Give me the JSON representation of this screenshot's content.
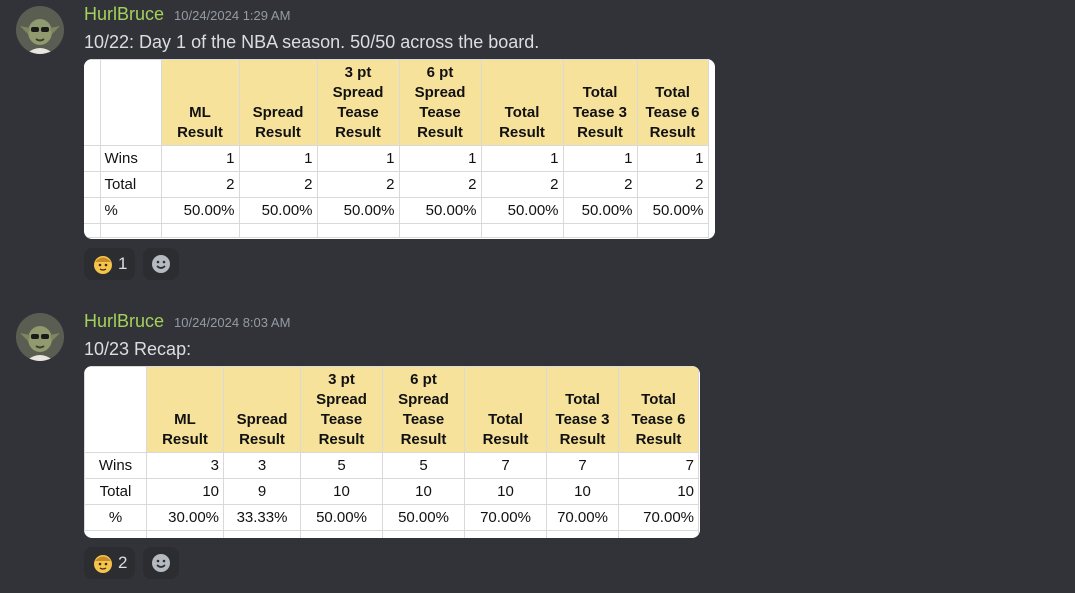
{
  "messages": [
    {
      "username": "HurlBruce",
      "timestamp": "10/24/2024 1:29 AM",
      "text": "10/22: Day 1 of the NBA season.  50/50 across the board.",
      "table": {
        "headers": [
          "ML Result",
          "Spread Result",
          "3 pt Spread Tease Result",
          "6 pt Spread Tease Result",
          "Total Result",
          "Total Tease 3 Result",
          "Total Tease 6 Result"
        ],
        "header_lines": [
          [
            "ML",
            "Result"
          ],
          [
            "Spread",
            "Result"
          ],
          [
            "3 pt",
            "Spread",
            "Tease",
            "Result"
          ],
          [
            "6 pt",
            "Spread",
            "Tease",
            "Result"
          ],
          [
            "Total",
            "Result"
          ],
          [
            "Total",
            "Tease 3",
            "Result"
          ],
          [
            "Total",
            "Tease 6",
            "Result"
          ]
        ],
        "rows": [
          {
            "label": "Wins",
            "values": [
              "1",
              "1",
              "1",
              "1",
              "1",
              "1",
              "1"
            ]
          },
          {
            "label": "Total",
            "values": [
              "2",
              "2",
              "2",
              "2",
              "2",
              "2",
              "2"
            ]
          },
          {
            "label": "%",
            "values": [
              "50.00%",
              "50.00%",
              "50.00%",
              "50.00%",
              "50.00%",
              "50.00%",
              "50.00%"
            ]
          }
        ]
      },
      "reaction": {
        "emoji": "face-emoji",
        "count": "1"
      }
    },
    {
      "username": "HurlBruce",
      "timestamp": "10/24/2024 8:03 AM",
      "text": "10/23 Recap:",
      "table": {
        "headers": [
          "ML Result",
          "Spread Result",
          "3 pt Spread Tease Result",
          "6 pt Spread Tease Result",
          "Total Result",
          "Total Tease 3 Result",
          "Total Tease 6 Result"
        ],
        "header_lines": [
          [
            "ML",
            "Result"
          ],
          [
            "Spread",
            "Result"
          ],
          [
            "3 pt",
            "Spread",
            "Tease",
            "Result"
          ],
          [
            "6 pt",
            "Spread",
            "Tease",
            "Result"
          ],
          [
            "Total",
            "Result"
          ],
          [
            "Total",
            "Tease 3",
            "Result"
          ],
          [
            "Total",
            "Tease 6",
            "Result"
          ]
        ],
        "rows": [
          {
            "label": "Wins",
            "values": [
              "3",
              "3",
              "5",
              "5",
              "7",
              "7",
              "7"
            ]
          },
          {
            "label": "Total",
            "values": [
              "10",
              "9",
              "10",
              "10",
              "10",
              "10",
              "10"
            ]
          },
          {
            "label": "%",
            "values": [
              "30.00%",
              "33.33%",
              "50.00%",
              "50.00%",
              "70.00%",
              "70.00%",
              "70.00%"
            ]
          }
        ]
      },
      "reaction": {
        "emoji": "face-emoji",
        "count": "2"
      }
    }
  ],
  "icons": {
    "avatar": "yoda-avatar",
    "add_reaction": "add-reaction-icon"
  },
  "colors": {
    "background": "#323339",
    "username": "#a4d15a",
    "header_fill": "#f6e29b"
  }
}
